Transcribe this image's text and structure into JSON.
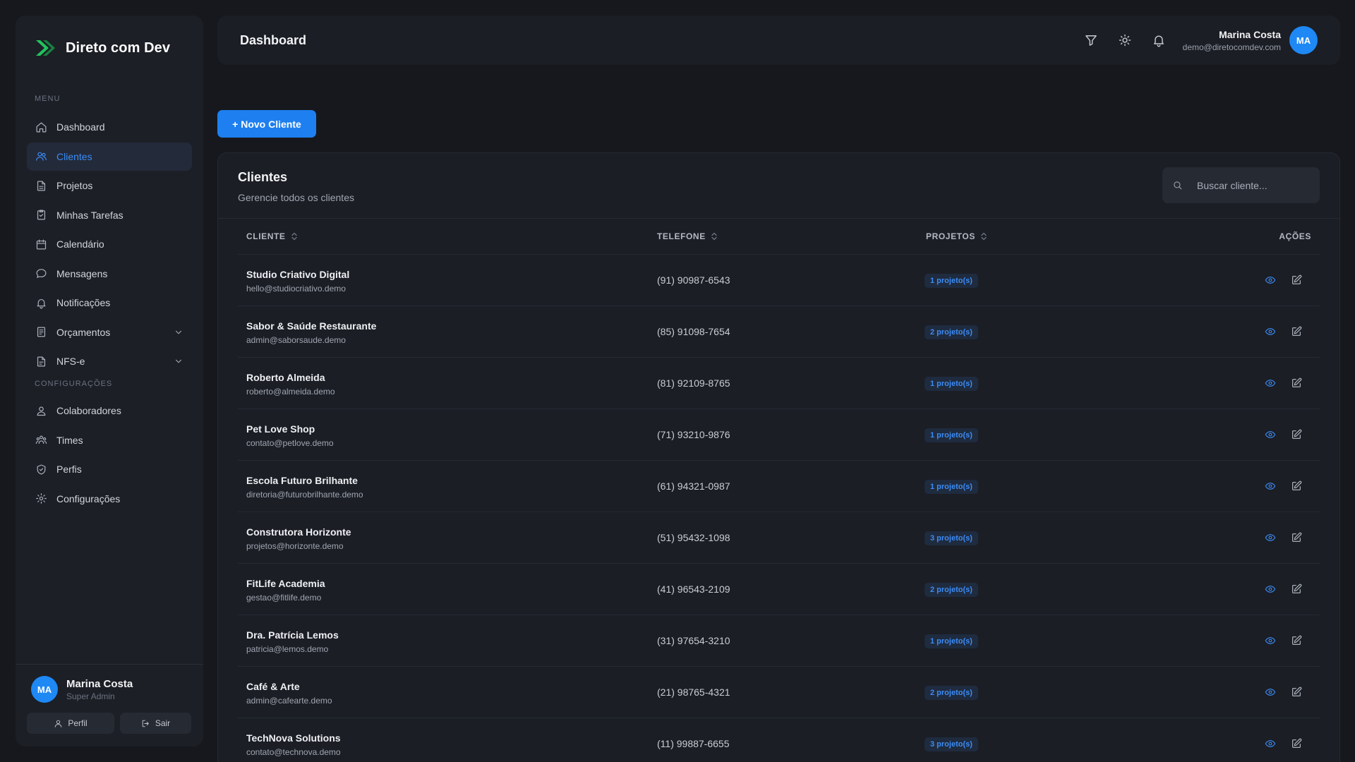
{
  "brand": {
    "name": "Direto com Dev"
  },
  "colors": {
    "accent": "#1e7ff0",
    "active_bg": "#232a3a",
    "badge_text": "#3b8cf6",
    "background": "#16181d",
    "panel": "#1b1e25"
  },
  "sidebar": {
    "menu_label": "MENU",
    "config_label": "CONFIGURAÇÕES",
    "items": [
      {
        "label": "Dashboard",
        "icon": "home-icon"
      },
      {
        "label": "Clientes",
        "icon": "users-icon",
        "active": true
      },
      {
        "label": "Projetos",
        "icon": "file-icon"
      },
      {
        "label": "Minhas Tarefas",
        "icon": "clipboard-check-icon"
      },
      {
        "label": "Calendário",
        "icon": "calendar-icon"
      },
      {
        "label": "Mensagens",
        "icon": "message-icon"
      },
      {
        "label": "Notificações",
        "icon": "bell-icon"
      },
      {
        "label": "Orçamentos",
        "icon": "receipt-icon",
        "expandable": true
      },
      {
        "label": "NFS-e",
        "icon": "file-text-icon",
        "expandable": true
      }
    ],
    "config_items": [
      {
        "label": "Colaboradores",
        "icon": "user-group-icon"
      },
      {
        "label": "Times",
        "icon": "team-icon"
      },
      {
        "label": "Perfis",
        "icon": "shield-icon"
      },
      {
        "label": "Configurações",
        "icon": "gear-icon"
      }
    ],
    "user": {
      "initials": "MA",
      "name": "Marina Costa",
      "role": "Super Admin"
    },
    "profile_button": "Perfil",
    "logout_button": "Sair"
  },
  "header": {
    "title": "Dashboard",
    "user": {
      "name": "Marina Costa",
      "email": "demo@diretocomdev.com",
      "initials": "MA"
    }
  },
  "actions": {
    "new_client": "+ Novo Cliente"
  },
  "clients_card": {
    "title": "Clientes",
    "subtitle": "Gerencie todos os clientes",
    "search_placeholder": "Buscar cliente...",
    "columns": {
      "client": "CLIENTE",
      "phone": "TELEFONE",
      "projects": "PROJETOS",
      "actions": "AÇÕES"
    },
    "rows": [
      {
        "name": "Studio Criativo Digital",
        "email": "hello@studiocriativo.demo",
        "phone": "(91) 90987-6543",
        "projects": "1 projeto(s)"
      },
      {
        "name": "Sabor & Saúde Restaurante",
        "email": "admin@saborsaude.demo",
        "phone": "(85) 91098-7654",
        "projects": "2 projeto(s)"
      },
      {
        "name": "Roberto Almeida",
        "email": "roberto@almeida.demo",
        "phone": "(81) 92109-8765",
        "projects": "1 projeto(s)"
      },
      {
        "name": "Pet Love Shop",
        "email": "contato@petlove.demo",
        "phone": "(71) 93210-9876",
        "projects": "1 projeto(s)"
      },
      {
        "name": "Escola Futuro Brilhante",
        "email": "diretoria@futurobrilhante.demo",
        "phone": "(61) 94321-0987",
        "projects": "1 projeto(s)"
      },
      {
        "name": "Construtora Horizonte",
        "email": "projetos@horizonte.demo",
        "phone": "(51) 95432-1098",
        "projects": "3 projeto(s)"
      },
      {
        "name": "FitLife Academia",
        "email": "gestao@fitlife.demo",
        "phone": "(41) 96543-2109",
        "projects": "2 projeto(s)"
      },
      {
        "name": "Dra. Patrícia Lemos",
        "email": "patricia@lemos.demo",
        "phone": "(31) 97654-3210",
        "projects": "1 projeto(s)"
      },
      {
        "name": "Café & Arte",
        "email": "admin@cafearte.demo",
        "phone": "(21) 98765-4321",
        "projects": "2 projeto(s)"
      },
      {
        "name": "TechNova Solutions",
        "email": "contato@technova.demo",
        "phone": "(11) 99887-6655",
        "projects": "3 projeto(s)"
      }
    ]
  }
}
